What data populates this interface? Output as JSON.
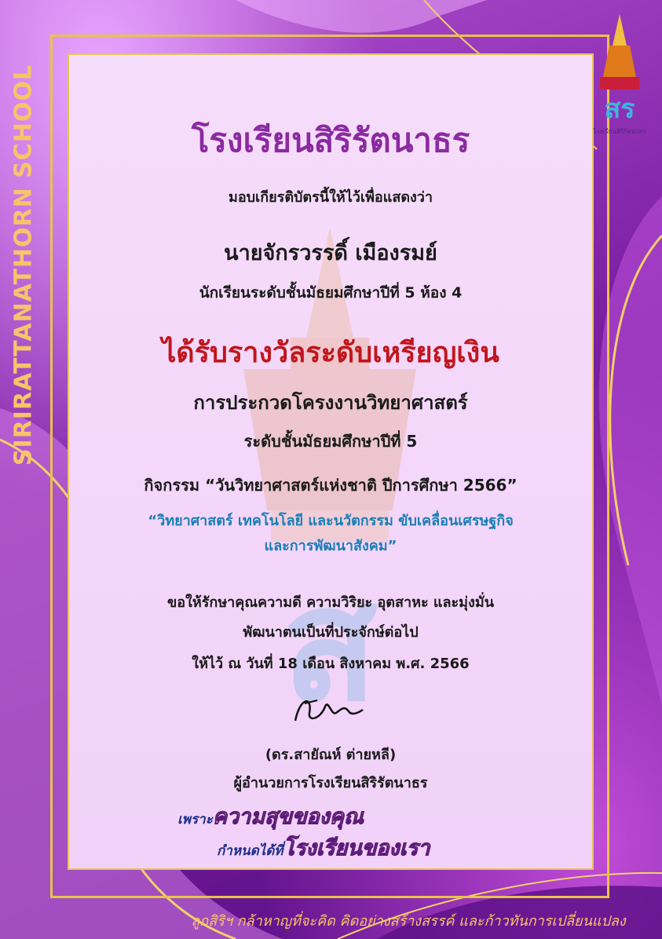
{
  "side_text": "SIRIRATTANATHORN SCHOOL",
  "school_name": "โรงเรียนสิริรัตนาธร",
  "intro": "มอบเกียรติบัตรนี้ให้ไว้เพื่อแสดงว่า",
  "recipient_name": "นายจักรวรรดิ์  เมืองรมย์",
  "recipient_class": "นักเรียนระดับชั้นมัธยมศึกษาปีที่ 5 ห้อง 4",
  "award": "ได้รับรางวัลระดับเหรียญเงิน",
  "contest": "การประกวดโครงงานวิทยาศาสตร์",
  "level": "ระดับชั้นมัธยมศึกษาปีที่ 5",
  "activity": "กิจกรรม “วันวิทยาศาสตร์แห่งชาติ ปีการศึกษา 2566”",
  "theme_line1": "“วิทยาศาสตร์ เทคโนโลยี และนวัตกรรม ขับเคลื่อนเศรษฐกิจ",
  "theme_line2": "และการพัฒนาสังคม”",
  "blessing_line1": "ขอให้รักษาคุณความดี ความวิริยะ อุตสาหะ และมุ่งมั่น",
  "blessing_line2": "พัฒนาตนเป็นที่ประจักษ์ต่อไป",
  "date": "ให้ไว้ ณ วันที่ 18 เดือน สิงหาคม พ.ศ. 2566",
  "signer_name": "(ดร.สายัณห์  ต่ายหลี)",
  "signer_title": "ผู้อำนวยการโรงเรียนสิริรัตนาธร",
  "slogan": {
    "part1_small": "เพราะ",
    "part1_big": "ความสุขของคุณ",
    "part2_small": "กำหนดได้ที่",
    "part2_big": "โรงเรียนของเรา"
  },
  "footer": "ลูกสิริฯ กล้าหาญที่จะคิด คิดอย่างสร้างสรรค์ และก้าวทันการเปลี่ยนแปลง",
  "logo_text": "โรงเรียนสิริรัตนาธร",
  "logo_letters": "สร",
  "colors": {
    "accent_gold": "#e8c24a",
    "purple": "#8a2aa0",
    "award_red": "#c0161d",
    "theme_blue": "#1a7fb6"
  }
}
